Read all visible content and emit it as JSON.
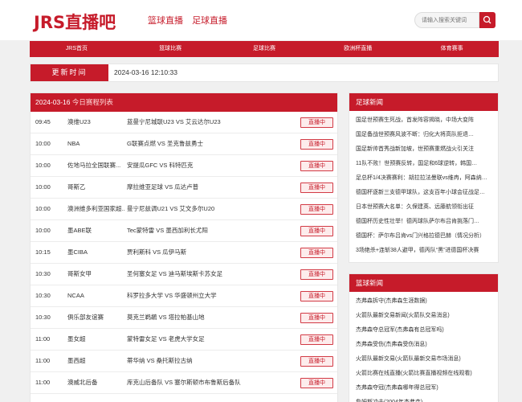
{
  "header": {
    "logo": "JRS直播吧",
    "topnav": [
      "篮球直播",
      "足球直播"
    ],
    "search_placeholder": "请输入搜索关键词"
  },
  "mainnav": [
    "JRS首页",
    "篮球比赛",
    "足球比赛",
    "欧洲杯直播",
    "体育赛事"
  ],
  "update": {
    "label": "更新时间",
    "time": "2024-03-16 12:10:33"
  },
  "matches": {
    "date": "2024-03-16",
    "title": "今日赛程列表",
    "live_label": "直播中",
    "rows": [
      {
        "time": "09:45",
        "league": "澳维U23",
        "teams": "蓝曼宁尼城联U23 VS 艾云达尔U23"
      },
      {
        "time": "10:00",
        "league": "NBA",
        "teams": "G联赛点燃 VS 圣克鲁兹勇士"
      },
      {
        "time": "10:00",
        "league": "佐地马拉全国联赛...",
        "teams": "安提瓜GFC VS 科特匹克"
      },
      {
        "time": "10:00",
        "league": "哥斯乙",
        "teams": "摩拉维亚足球 VS 瓜达卢普"
      },
      {
        "time": "10:00",
        "league": "澳洲维多利亚国家超...",
        "teams": "曼宁尼兹调U21 VS 艾文多尔U20"
      },
      {
        "time": "10:00",
        "league": "墨ABE联",
        "teams": "Tec蒙特雷 VS 墨西加利长尤阳"
      },
      {
        "time": "10:15",
        "league": "墨CIBA",
        "teams": "贾利斯科 VS 瓜伊马斯"
      },
      {
        "time": "10:30",
        "league": "哥斯女甲",
        "teams": "圣何塞女足 VS 迪马斯埃斯卡苏女足"
      },
      {
        "time": "10:30",
        "league": "NCAA",
        "teams": "科罗拉多大学 VS 华盛顿州立大学"
      },
      {
        "time": "10:30",
        "league": "俱乐部友谊赛",
        "teams": "莫克兰鹈鹕 VS 塔拉帕基山地"
      },
      {
        "time": "11:00",
        "league": "墨女超",
        "teams": "蒙特雷女足 VS 老虎大学女足"
      },
      {
        "time": "11:00",
        "league": "墨西超",
        "teams": "蒂华纳 VS 桑托斯拉古纳"
      },
      {
        "time": "11:00",
        "league": "澳威北后备",
        "teams": "库克山后备队 VS 塞尔斯顿市布鲁斯后备队"
      }
    ]
  },
  "football_news": {
    "title": "足球新闻",
    "items": [
      "国足世预赛生死战，首发阵容揭晓，中场大变阵",
      "国足备战世预赛风波不断：归化大将高队拒退…",
      "国足新帅首秀战新加坡，世预赛重燃战火引关注",
      "11队不败！世预赛反转，国足和6球逆转，韩国…",
      "足总杯1/4决赛赛利：胡拉拉法曼联vs维冉，阿森纳…",
      "德国杯逐新三支德甲球队，这支百年小球会征战足…",
      "日本世预赛大名单：久保建英、远藤航领衔出征",
      "德国杯历史性壮举！德丙球队萨尔布吕肯挑落门…",
      "德国杯：萨尔布吕肯vs门兴格拉德巴赫（情况分析）",
      "3场绝杀+连斩38人避甲，德丙队“黑”进德国杯决赛"
    ]
  },
  "basketball_news": {
    "title": "篮球新闻",
    "items": [
      "杰弗森拆守(杰弗森生涯数据)",
      "火箭队最新交易新闻(火箭队交易消息)",
      "杰弗森夺总冠军(杰弗森有总冠军吗)",
      "杰弗森受伤(杰弗森受伤消息)",
      "火箭队最新交易(火箭队最新交易市场消息)",
      "火箭比赛在线直播(火箭比赛直播视频在线观看)",
      "杰弗森夺冠(杰弗森哪年得总冠军)",
      "詹姆斯冲击(2004年杰弗森)"
    ]
  },
  "colors": {
    "brand": "#c61b2a"
  },
  "icons": {
    "search": "search-icon"
  }
}
